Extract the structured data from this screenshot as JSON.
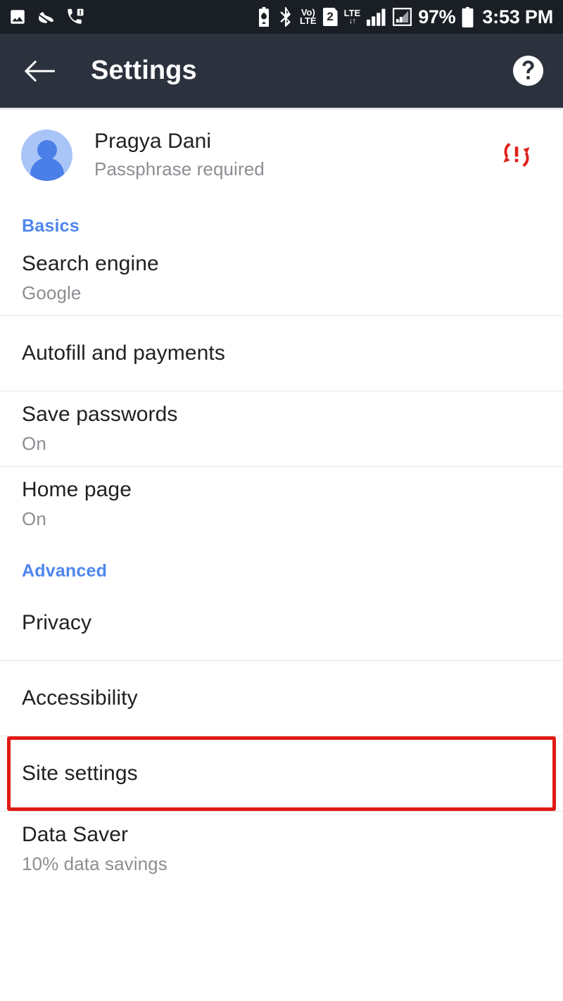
{
  "status_bar": {
    "left_icons": [
      "image-icon",
      "shoe-icon",
      "phone-alert-icon"
    ],
    "right_icons": [
      "battery-saver-icon",
      "bluetooth-icon",
      "volte-icon",
      "sim-2-icon",
      "lte-data-icon",
      "signal-bars-icon",
      "signal-bars-secondary-icon"
    ],
    "volte_top": "Vo)",
    "volte_bottom": "LTE",
    "lte_top": "LTE",
    "lte_arrows": "↓↑",
    "sim_label": "2",
    "battery_percent": "97%",
    "clock": "3:53 PM"
  },
  "toolbar": {
    "title": "Settings",
    "back_icon": "back-arrow-icon",
    "help_icon": "help-circle-icon"
  },
  "account": {
    "name": "Pragya Dani",
    "status": "Passphrase required",
    "sync_icon": "sync-error-icon",
    "avatar_icon": "person-avatar-icon"
  },
  "sections": [
    {
      "header": "Basics",
      "items": [
        {
          "title": "Search engine",
          "subtitle": "Google"
        },
        {
          "title": "Autofill and payments",
          "subtitle": ""
        },
        {
          "title": "Save passwords",
          "subtitle": "On"
        },
        {
          "title": "Home page",
          "subtitle": "On"
        }
      ]
    },
    {
      "header": "Advanced",
      "items": [
        {
          "title": "Privacy",
          "subtitle": ""
        },
        {
          "title": "Accessibility",
          "subtitle": ""
        },
        {
          "title": "Site settings",
          "subtitle": "",
          "highlighted": true
        },
        {
          "title": "Data Saver",
          "subtitle": "10% data savings"
        }
      ]
    }
  ],
  "colors": {
    "status_bar_bg": "#1a1f26",
    "toolbar_bg": "#2b323d",
    "accent_blue": "#4e86ef",
    "highlight_red": "#e01a14",
    "primary_text": "#202124",
    "secondary_text": "#8b8e92",
    "avatar_bg": "#a9c5f8",
    "avatar_fg": "#4a7fe8"
  }
}
